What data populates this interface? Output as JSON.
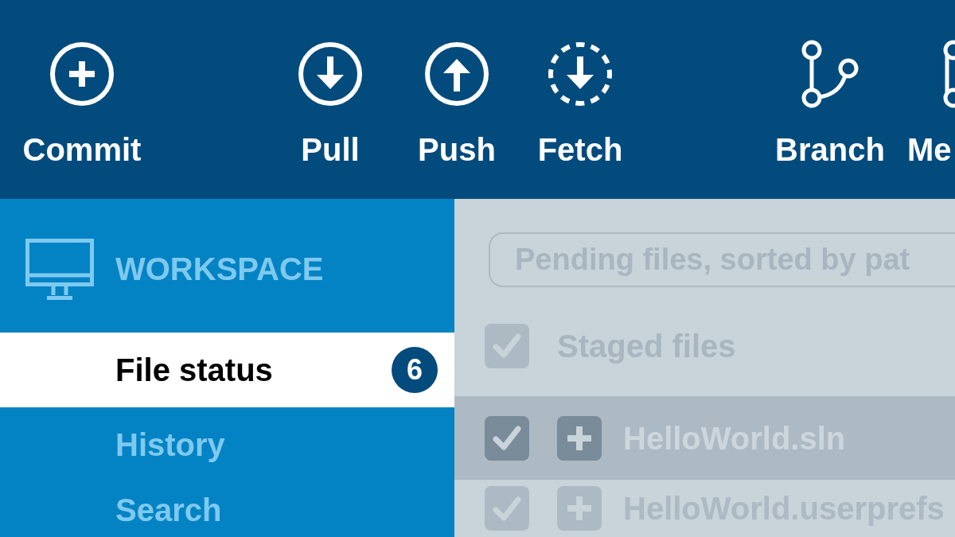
{
  "toolbar": {
    "buttons": [
      {
        "label": "Commit",
        "kind": "plus-circle"
      },
      {
        "label": "Pull",
        "kind": "arrow-down-circle"
      },
      {
        "label": "Push",
        "kind": "arrow-up-circle"
      },
      {
        "label": "Fetch",
        "kind": "dashed-arrow-down"
      },
      {
        "label": "Branch",
        "kind": "fork"
      },
      {
        "label": "Me",
        "kind": "nodes"
      }
    ]
  },
  "sidebar": {
    "section_title": "WORKSPACE",
    "items": [
      {
        "label": "File status",
        "selected": true,
        "badge": "6"
      },
      {
        "label": "History",
        "selected": false
      },
      {
        "label": "Search",
        "selected": false
      }
    ]
  },
  "file_list": {
    "search": {
      "placeholder": "Pending files, sorted by pat"
    },
    "header": {
      "label": "Staged files",
      "checked": true
    },
    "files": [
      {
        "name": "HelloWorld.sln",
        "checked": true,
        "selected": true,
        "kind": "added"
      },
      {
        "name": "HelloWorld.userprefs",
        "checked": true,
        "selected": false,
        "kind": "added"
      }
    ]
  }
}
